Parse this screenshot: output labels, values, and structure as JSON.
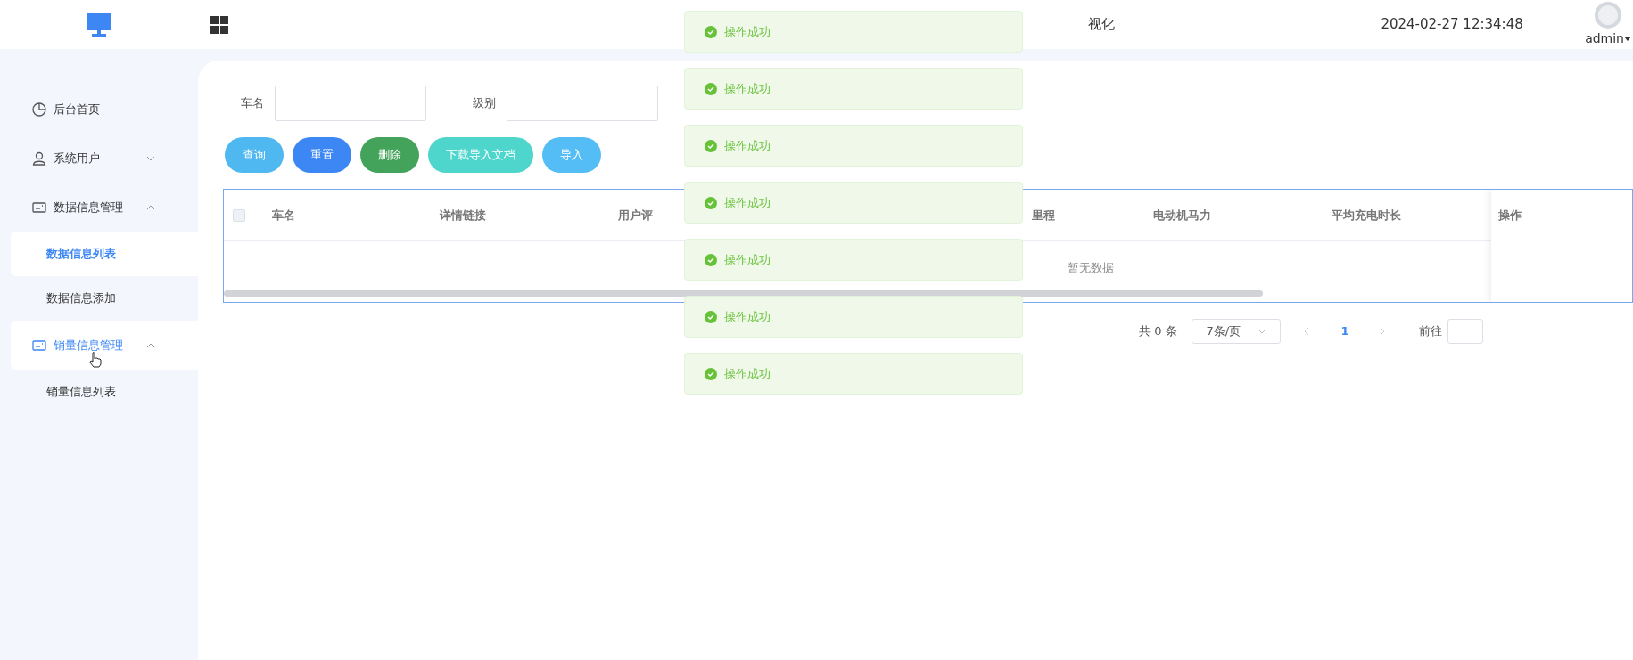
{
  "header": {
    "title": "视化",
    "datetime": "2024-02-27 12:34:48",
    "user": "admin"
  },
  "sidebar": {
    "items": [
      {
        "kind": "link",
        "label": "后台首页",
        "highlighted": false
      },
      {
        "kind": "group",
        "label": "系统用户",
        "expanded": false,
        "highlighted": false
      },
      {
        "kind": "group",
        "label": "数据信息管理",
        "expanded": true,
        "highlighted": false,
        "children": [
          {
            "label": "数据信息列表",
            "selected": true
          },
          {
            "label": "数据信息添加",
            "selected": false
          }
        ]
      },
      {
        "kind": "group",
        "label": "销量信息管理",
        "expanded": true,
        "highlighted": true,
        "children": [
          {
            "label": "销量信息列表",
            "selected": false
          }
        ]
      }
    ]
  },
  "filters": [
    {
      "label": "车名"
    },
    {
      "label": "级别"
    }
  ],
  "buttons": [
    {
      "label": "查询",
      "color": "#4fb8f0"
    },
    {
      "label": "重置",
      "color": "#3d87f5"
    },
    {
      "label": "删除",
      "color": "#44a35a"
    },
    {
      "label": "下载导入文档",
      "color": "#4fd6cc"
    },
    {
      "label": "导入",
      "color": "#55bdf5"
    }
  ],
  "table": {
    "select_all": {
      "checked": false
    },
    "columns": [
      "车名",
      "详情链接",
      "用户评",
      "",
      "里程",
      "电动机马力",
      "平均充电时长"
    ],
    "action_column": "操作",
    "empty_text": "暂无数据"
  },
  "pagination": {
    "total": "共 0 条",
    "page_size": "7条/页",
    "pages": [
      {
        "label": "1",
        "selected": true
      }
    ],
    "goto_label": "前往"
  },
  "toasts": [
    "操作成功",
    "操作成功",
    "操作成功",
    "操作成功",
    "操作成功",
    "操作成功",
    "操作成功"
  ]
}
